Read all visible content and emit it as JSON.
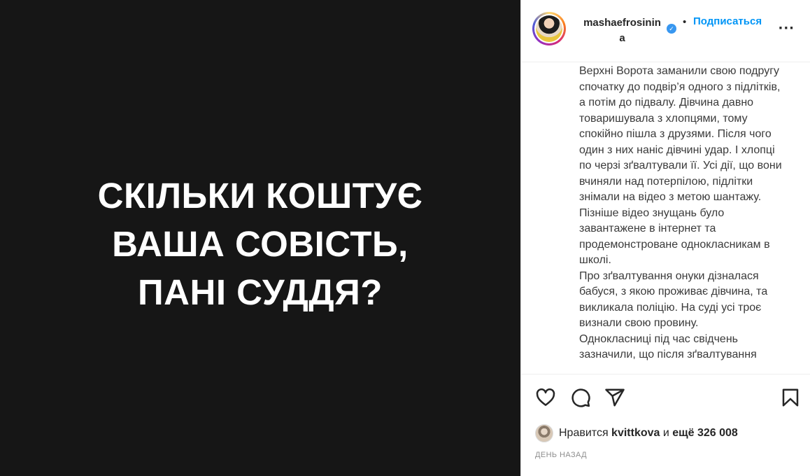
{
  "media": {
    "lines": [
      "СКІЛЬКИ КОШТУЄ",
      "ВАША СОВІСТЬ,",
      "ПАНІ СУДДЯ?"
    ],
    "background": "#161616"
  },
  "header": {
    "username_line1": "mashaefrosinin",
    "username_line2": "a",
    "verified_icon": "verified-badge-icon",
    "separator": "•",
    "follow_label": "Подписаться",
    "more_label": "•••"
  },
  "caption": {
    "paragraph1": "Верхні Ворота заманили свою подругу спочатку до подвір’я одного з підлітків, а потім до підвалу. Дівчина давно товаришувала з хлопцями, тому спокійно пішла з друзями. Після чого один з них наніс дівчині удар. І хлопці по черзі зґвалтували її. Усі дії, що вони вчиняли над потерпілою, підлітки знімали на відео з метою шантажу. Пізніше відео знущань було завантажене в інтернет та продемонстроване однокласникам в школі.",
    "paragraph2": "Про зґвалтування онуки дізналася бабуся, з якою проживає дівчина, та викликала поліцію. На суді усі троє визнали свою провину.",
    "paragraph3": "Однокласниці під час свідчень зазначили, що після зґвалтування"
  },
  "actions": {
    "like_icon": "heart-icon",
    "comment_icon": "comment-icon",
    "share_icon": "share-icon",
    "save_icon": "bookmark-icon"
  },
  "likes": {
    "prefix": "Нравится ",
    "liker": "kvittkova",
    "middle": " и ",
    "rest": "ещё 326 008"
  },
  "timestamp": "ДЕНЬ НАЗАД",
  "colors": {
    "accent": "#0095f6",
    "verified": "#3897f0",
    "text": "#262626",
    "muted": "#8e8e8e"
  }
}
